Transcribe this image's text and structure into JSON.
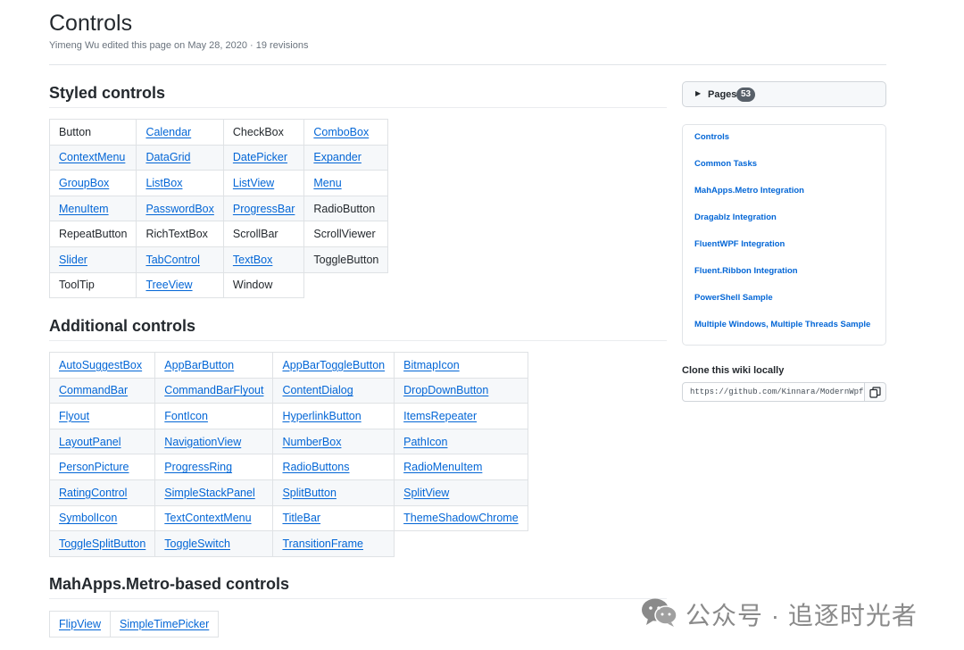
{
  "header": {
    "title": "Controls",
    "meta": "Yimeng Wu edited this page on May 28, 2020 · 19 revisions"
  },
  "styled": {
    "title": "Styled controls",
    "rows": [
      [
        {
          "t": "Button",
          "l": false
        },
        {
          "t": "Calendar",
          "l": true
        },
        {
          "t": "CheckBox",
          "l": false
        },
        {
          "t": "ComboBox",
          "l": true
        }
      ],
      [
        {
          "t": "ContextMenu",
          "l": true
        },
        {
          "t": "DataGrid",
          "l": true
        },
        {
          "t": "DatePicker",
          "l": true
        },
        {
          "t": "Expander",
          "l": true
        }
      ],
      [
        {
          "t": "GroupBox",
          "l": true
        },
        {
          "t": "ListBox",
          "l": true
        },
        {
          "t": "ListView",
          "l": true
        },
        {
          "t": "Menu",
          "l": true
        }
      ],
      [
        {
          "t": "MenuItem",
          "l": true
        },
        {
          "t": "PasswordBox",
          "l": true
        },
        {
          "t": "ProgressBar",
          "l": true
        },
        {
          "t": "RadioButton",
          "l": false
        }
      ],
      [
        {
          "t": "RepeatButton",
          "l": false
        },
        {
          "t": "RichTextBox",
          "l": false
        },
        {
          "t": "ScrollBar",
          "l": false
        },
        {
          "t": "ScrollViewer",
          "l": false
        }
      ],
      [
        {
          "t": "Slider",
          "l": true
        },
        {
          "t": "TabControl",
          "l": true
        },
        {
          "t": "TextBox",
          "l": true
        },
        {
          "t": "ToggleButton",
          "l": false
        }
      ],
      [
        {
          "t": "ToolTip",
          "l": false
        },
        {
          "t": "TreeView",
          "l": true
        },
        {
          "t": "Window",
          "l": false
        },
        null
      ]
    ]
  },
  "additional": {
    "title": "Additional controls",
    "rows": [
      [
        {
          "t": "AutoSuggestBox",
          "l": true
        },
        {
          "t": "AppBarButton",
          "l": true
        },
        {
          "t": "AppBarToggleButton",
          "l": true
        },
        {
          "t": "BitmapIcon",
          "l": true
        }
      ],
      [
        {
          "t": "CommandBar",
          "l": true
        },
        {
          "t": "CommandBarFlyout",
          "l": true
        },
        {
          "t": "ContentDialog",
          "l": true
        },
        {
          "t": "DropDownButton",
          "l": true
        }
      ],
      [
        {
          "t": "Flyout",
          "l": true
        },
        {
          "t": "FontIcon",
          "l": true
        },
        {
          "t": "HyperlinkButton",
          "l": true
        },
        {
          "t": "ItemsRepeater",
          "l": true
        }
      ],
      [
        {
          "t": "LayoutPanel",
          "l": true
        },
        {
          "t": "NavigationView",
          "l": true
        },
        {
          "t": "NumberBox",
          "l": true
        },
        {
          "t": "PathIcon",
          "l": true
        }
      ],
      [
        {
          "t": "PersonPicture",
          "l": true
        },
        {
          "t": "ProgressRing",
          "l": true
        },
        {
          "t": "RadioButtons",
          "l": true
        },
        {
          "t": "RadioMenuItem",
          "l": true
        }
      ],
      [
        {
          "t": "RatingControl",
          "l": true
        },
        {
          "t": "SimpleStackPanel",
          "l": true
        },
        {
          "t": "SplitButton",
          "l": true
        },
        {
          "t": "SplitView",
          "l": true
        }
      ],
      [
        {
          "t": "SymbolIcon",
          "l": true
        },
        {
          "t": "TextContextMenu",
          "l": true
        },
        {
          "t": "TitleBar",
          "l": true
        },
        {
          "t": "ThemeShadowChrome",
          "l": true
        }
      ],
      [
        {
          "t": "ToggleSplitButton",
          "l": true
        },
        {
          "t": "ToggleSwitch",
          "l": true
        },
        {
          "t": "TransitionFrame",
          "l": true
        },
        null
      ]
    ]
  },
  "mahapps": {
    "title": "MahApps.Metro-based controls",
    "rows": [
      [
        {
          "t": "FlipView",
          "l": true
        },
        {
          "t": "SimpleTimePicker",
          "l": true
        }
      ]
    ]
  },
  "sidebar": {
    "pages_label": "Pages",
    "pages_count": "53",
    "links": [
      "Controls",
      "Common Tasks",
      "MahApps.Metro Integration",
      "Dragablz Integration",
      "FluentWPF Integration",
      "Fluent.Ribbon Integration",
      "PowerShell Sample",
      "Multiple Windows, Multiple Threads Sample"
    ],
    "clone_label": "Clone this wiki locally",
    "clone_url": "https://github.com/Kinnara/ModernWpf"
  },
  "watermark": {
    "text": "公众号 · 追逐时光者"
  }
}
